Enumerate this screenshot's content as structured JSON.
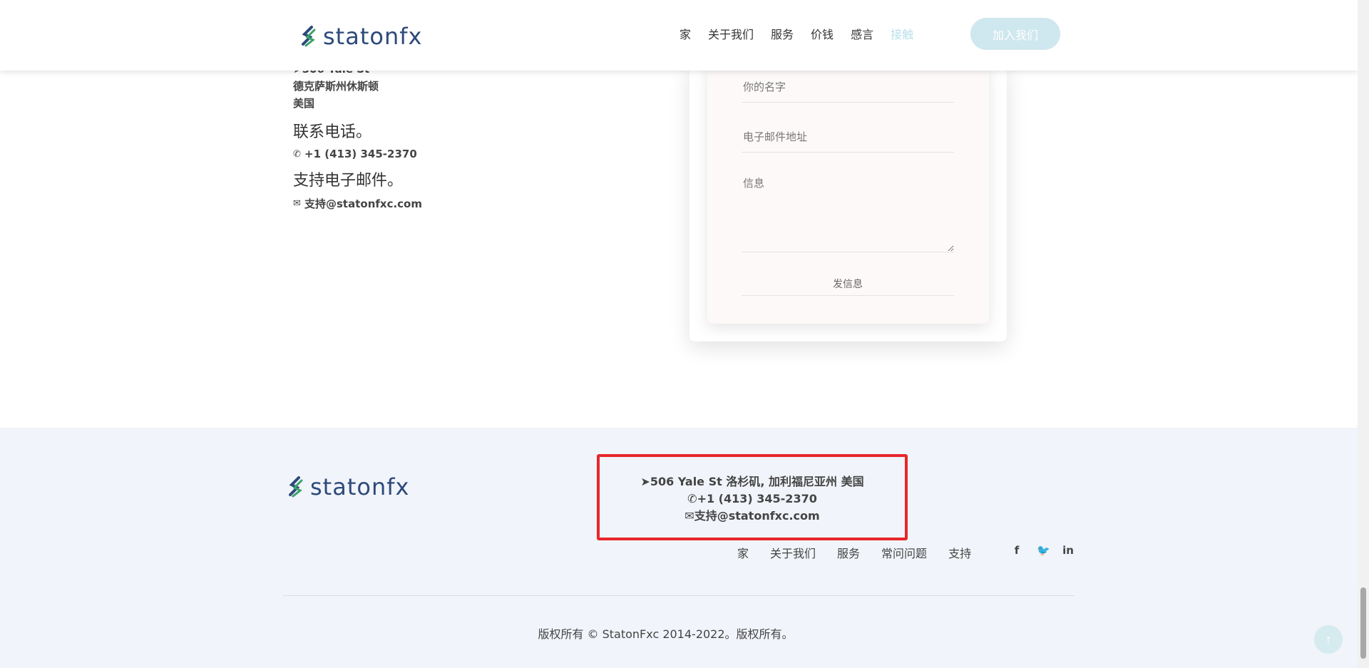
{
  "header": {
    "logo_text": "statonfx",
    "nav": [
      "家",
      "关于我们",
      "服务",
      "价钱",
      "感言",
      "接触"
    ],
    "active_nav": "接触",
    "join_label": "加入我们"
  },
  "contact": {
    "address_lines": [
      "506 Yale St",
      "德克萨斯州休斯顿",
      "美国"
    ],
    "phone_heading": "联系电话。",
    "phone": "+1 (413) 345-2370",
    "email_heading": "支持电子邮件。",
    "email": "支持@statonfxc.com"
  },
  "form": {
    "name_placeholder": "你的名字",
    "email_placeholder": "电子邮件地址",
    "message_placeholder": "信息",
    "send_label": "发信息"
  },
  "footer": {
    "logo_text": "statonfx",
    "address": "506 Yale St 洛杉矶, 加利福尼亚州 美国",
    "phone": "+1 (413) 345-2370",
    "email": "支持@statonfxc.com",
    "nav": [
      "家",
      "关于我们",
      "服务",
      "常问问题",
      "支持"
    ],
    "social": [
      "facebook-icon",
      "twitter-icon",
      "linkedin-icon"
    ],
    "social_glyphs": [
      "f",
      "🐦",
      "in"
    ],
    "copyright": "版权所有 © StatonFxc 2014-2022。版权所有。"
  },
  "colors": {
    "brand_blue": "#2d4a7a",
    "brand_green": "#3aa36b",
    "accent_light": "#cfe7ee",
    "highlight_red": "#e8262a",
    "footer_bg": "#f1f4fa"
  }
}
